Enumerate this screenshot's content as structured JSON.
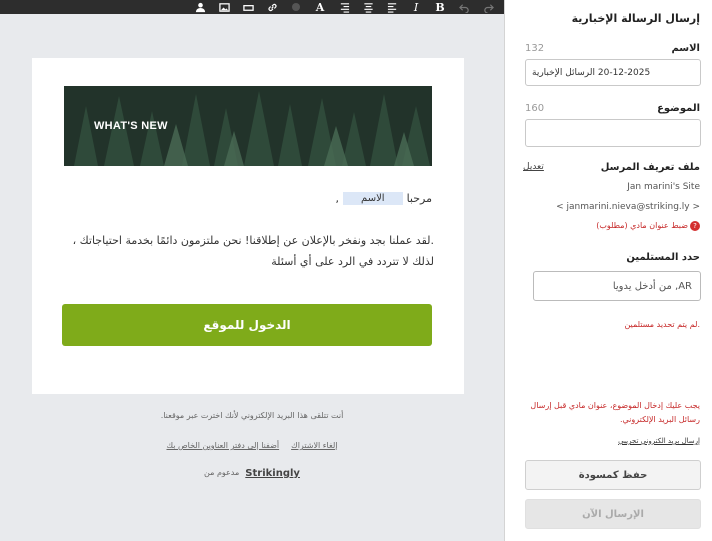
{
  "toolbar": {
    "icons": [
      "person-icon",
      "image-icon",
      "button-icon",
      "link-icon",
      "color-dot",
      "font-icon",
      "align-right-icon",
      "align-center-icon",
      "align-left-icon",
      "italic-icon",
      "bold-icon",
      "undo-icon",
      "redo-icon"
    ],
    "font_label": "A",
    "italic_label": "I",
    "bold_label": "B"
  },
  "email": {
    "banner_text": "WHAT'S NEW",
    "greeting": "مرحبا",
    "name_placeholder": "الاسم",
    "comma": ",",
    "body": ".لقد عملنا بجد ونفخر بالإعلان عن إطلاقنا! نحن ملتزمون دائمًا بخدمة احتياجاتك ، لذلك لا تتردد في الرد على أي أسئلة",
    "cta_label": "الدخول للموقع",
    "footer_line1": "أنت تتلقى هذا البريد الإلكتروني لأنك اخترت عبر موقعنا.",
    "footer_link_add": "أضفنا إلى دفتر العناوين الخاص بك",
    "footer_link_unsub": "إلغاء الاشتراك",
    "powered_by": "مدعوم من",
    "brand": "Strikingly"
  },
  "panel": {
    "title": "إرسال الرسالة الإخبارية",
    "name_label": "الاسم",
    "name_count": "132",
    "name_value": "20-12-2025 الرسائل الإخبارية",
    "subject_label": "الموضوع",
    "subject_count": "160",
    "subject_value": "",
    "sender_label": "ملف تعريف المرسل",
    "edit_link": "تعديل",
    "sender_name": "Jan marini's Site",
    "sender_email": "< janmarini.nieva@striking.ly >",
    "sender_error": "ضبط عنوان مادي (مطلوب)",
    "recipients_label": "حدد المستلمين",
    "recipients_placeholder": "AR, من أدخل يدويا",
    "recipients_error": ".لم يتم تحديد مستلمين",
    "submit_error": "يجب عليك إدخال الموضوع، عنوان مادي قبل إرسال رسائل البريد الإلكتروني.",
    "test_link": "إرسال بريد الكتروني تجريبي",
    "save_draft": "حفظ كمسودة",
    "send_now": "الإرسال الآن"
  }
}
